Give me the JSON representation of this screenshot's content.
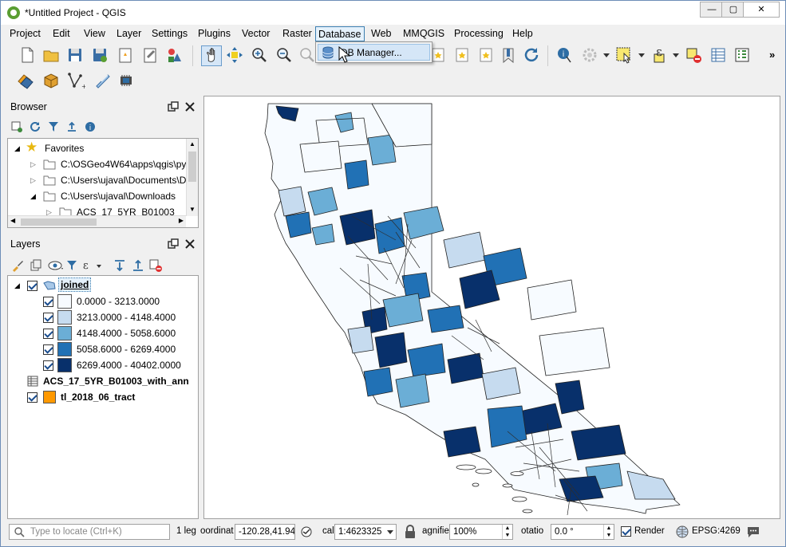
{
  "window": {
    "title": "*Untitled Project - QGIS",
    "minimize": "—",
    "maximize": "▢",
    "close": "✕"
  },
  "menubar": {
    "items": [
      "Project",
      "Edit",
      "View",
      "Layer",
      "Settings",
      "Plugins",
      "Vector",
      "Raster",
      "Database",
      "Web",
      "MMQGIS",
      "Processing",
      "Help"
    ],
    "active": "Database"
  },
  "database_menu": {
    "items": [
      "DB Manager..."
    ]
  },
  "browser": {
    "title": "Browser",
    "tree": [
      {
        "label": "Favorites",
        "icon": "star-icon"
      },
      {
        "label": "C:\\OSGeo4W64\\apps\\qgis\\py"
      },
      {
        "label": "C:\\Users\\ujaval\\Documents\\D"
      },
      {
        "label": "C:\\Users\\ujaval\\Downloads"
      },
      {
        "label": "ACS_17_5YR_B01003"
      }
    ]
  },
  "layers": {
    "title": "Layers",
    "joined": {
      "name": "joined",
      "checked": true
    },
    "classes": [
      {
        "range": "0.0000 - 3213.0000",
        "color": "#f7fbff"
      },
      {
        "range": "3213.0000 - 4148.4000",
        "color": "#c6dbef"
      },
      {
        "range": "4148.4000 - 5058.6000",
        "color": "#6baed6"
      },
      {
        "range": "5058.6000 - 6269.4000",
        "color": "#2171b5"
      },
      {
        "range": "6269.4000 - 40402.0000",
        "color": "#08306b"
      }
    ],
    "table_layer": {
      "name": "ACS_17_5YR_B01003_with_ann"
    },
    "tract_layer": {
      "name": "tl_2018_06_tract",
      "color": "#ff9900"
    }
  },
  "status": {
    "locate_placeholder": "Type to locate (Ctrl+K)",
    "legend": "1 leg",
    "coord_label": "oordinat",
    "coordinate": "-120.28,41.94",
    "scale_label": "cal",
    "scale": "1:4623325",
    "magnifier_label": "agnifie",
    "magnifier": "100%",
    "rotation_label": "otatio",
    "rotation": "0.0 °",
    "render": "Render",
    "crs": "EPSG:4269"
  }
}
